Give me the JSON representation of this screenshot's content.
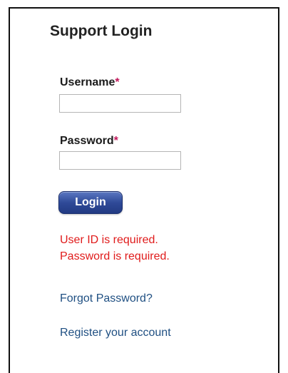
{
  "login_form": {
    "title": "Support Login",
    "username": {
      "label": "Username",
      "required_marker": "*",
      "value": "",
      "placeholder": ""
    },
    "password": {
      "label": "Password",
      "required_marker": "*",
      "value": "",
      "placeholder": ""
    },
    "login_button_label": "Login",
    "errors": [
      "User ID is required.",
      "Password is required."
    ],
    "links": {
      "forgot_password": "Forgot Password?",
      "register": "Register your account"
    }
  },
  "colors": {
    "error_text": "#e01b1b",
    "required_marker": "#c2185b",
    "link_text": "#1f4f82",
    "button_background": "#2f4a98",
    "button_text": "#ffffff"
  }
}
